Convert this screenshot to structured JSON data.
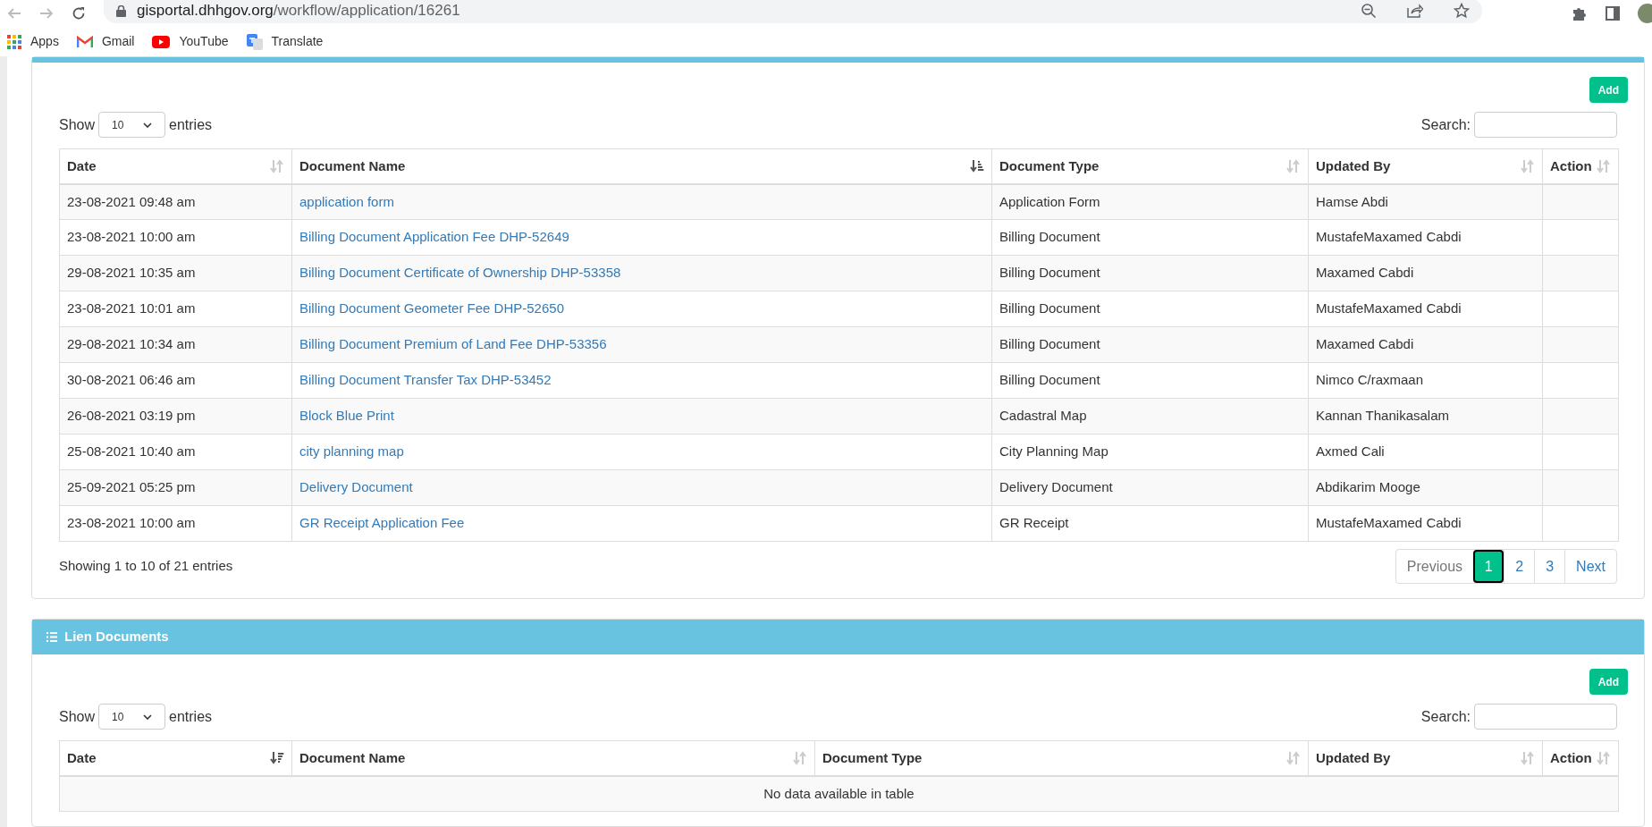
{
  "browser": {
    "url_host": "gisportal.dhhgov.org",
    "url_path": "/workflow/application/16261",
    "bookmarks": [
      {
        "label": "Apps",
        "kind": "apps"
      },
      {
        "label": "Gmail",
        "kind": "gmail"
      },
      {
        "label": "YouTube",
        "kind": "youtube"
      },
      {
        "label": "Translate",
        "kind": "translate"
      }
    ]
  },
  "sections": [
    {
      "add_button": "Add",
      "show_label": "Show",
      "length": "10",
      "entries_label": "entries",
      "search_label": "Search:",
      "columns": [
        {
          "label": "Date",
          "kind": "text",
          "sorted": false
        },
        {
          "label": "Document Name",
          "kind": "link",
          "sorted": true,
          "descending": false
        },
        {
          "label": "Document Type",
          "kind": "text",
          "sorted": false
        },
        {
          "label": "Updated By",
          "kind": "text",
          "sorted": false
        },
        {
          "label": "Action",
          "kind": "text",
          "sorted": false
        }
      ],
      "rows": [
        [
          "23-08-2021 09:48 am",
          "application form",
          "Application Form",
          "Hamse Abdi",
          ""
        ],
        [
          "23-08-2021 10:00 am",
          "Billing Document Application Fee DHP-52649",
          "Billing Document",
          "MustafeMaxamed Cabdi",
          ""
        ],
        [
          "29-08-2021 10:35 am",
          "Billing Document Certificate of Ownership DHP-53358",
          "Billing Document",
          "Maxamed Cabdi",
          ""
        ],
        [
          "23-08-2021 10:01 am",
          "Billing Document Geometer Fee DHP-52650",
          "Billing Document",
          "MustafeMaxamed Cabdi",
          ""
        ],
        [
          "29-08-2021 10:34 am",
          "Billing Document Premium of Land Fee DHP-53356",
          "Billing Document",
          "Maxamed Cabdi",
          ""
        ],
        [
          "30-08-2021 06:46 am",
          "Billing Document Transfer Tax DHP-53452",
          "Billing Document",
          "Nimco C/raxmaan",
          ""
        ],
        [
          "26-08-2021 03:19 pm",
          "Block Blue Print",
          "Cadastral Map",
          "Kannan Thanikasalam",
          ""
        ],
        [
          "25-08-2021 10:40 am",
          "city planning map",
          "City Planning Map",
          "Axmed Cali",
          ""
        ],
        [
          "25-09-2021 05:25 pm",
          "Delivery Document",
          "Delivery Document",
          "Abdikarim Mooge",
          ""
        ],
        [
          "23-08-2021 10:00 am",
          "GR Receipt Application Fee",
          "GR Receipt",
          "MustafeMaxamed Cabdi",
          ""
        ]
      ],
      "info": "Showing 1 to 10 of 21 entries",
      "pagination": {
        "previous": {
          "label": "Previous",
          "disabled": true
        },
        "pages": [
          {
            "label": "1",
            "selected": true
          },
          {
            "label": "2",
            "selected": false
          },
          {
            "label": "3",
            "selected": false
          }
        ],
        "next": {
          "label": "Next",
          "disabled": false
        }
      }
    },
    {
      "title": "Lien Documents",
      "add_button": "Add",
      "show_label": "Show",
      "length": "10",
      "entries_label": "entries",
      "search_label": "Search:",
      "columns": [
        {
          "label": "Date",
          "sorted": true,
          "descending": true
        },
        {
          "label": "Document Name",
          "sorted": false
        },
        {
          "label": "Document Type",
          "sorted": false
        },
        {
          "label": "Updated By",
          "sorted": false
        },
        {
          "label": "Action",
          "sorted": false
        }
      ],
      "empty_message": "No data available in table"
    }
  ]
}
